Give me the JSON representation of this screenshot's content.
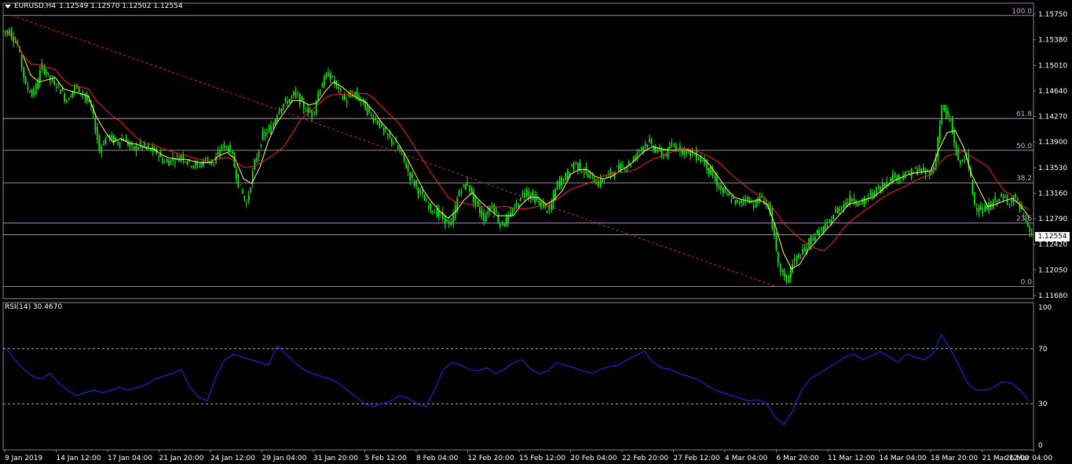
{
  "chart_header": {
    "menu_icon": "triangle-down-icon",
    "symbol": "EURUSD,H4",
    "ohlc": "1.12549 1.12570 1.12502 1.12554"
  },
  "current_price": "1.12554",
  "price_axis_labels": [
    "1.15750",
    "1.15380",
    "1.15010",
    "1.14640",
    "1.14270",
    "1.13900",
    "1.13530",
    "1.13160",
    "1.12790",
    "1.12420",
    "1.12050",
    "1.11680"
  ],
  "fibonacci": {
    "color": "#d0a8e0",
    "levels": [
      {
        "label": "100.0",
        "price": 1.1573
      },
      {
        "label": "61.8",
        "price": 1.1424
      },
      {
        "label": "50.0",
        "price": 1.1378
      },
      {
        "label": "38.2",
        "price": 1.1331
      },
      {
        "label": "23.6",
        "price": 1.1273
      },
      {
        "label": "0.0",
        "price": 1.1181
      }
    ]
  },
  "horizontal_line_price": 1.1256,
  "trendline": {
    "color": "#d03030",
    "from": {
      "x": "9 Jan 2019",
      "y": 1.1573
    },
    "to": {
      "x": "6 Mar 20:00",
      "y": 1.1181
    }
  },
  "time_axis_labels": [
    "9 Jan 2019",
    "14 Jan 12:00",
    "17 Jan 04:00",
    "21 Jan 20:00",
    "24 Jan 12:00",
    "29 Jan 04:00",
    "31 Jan 20:00",
    "5 Feb 12:00",
    "8 Feb 04:00",
    "12 Feb 20:00",
    "15 Feb 12:00",
    "20 Feb 04:00",
    "22 Feb 20:00",
    "27 Feb 12:00",
    "4 Mar 04:00",
    "6 Mar 20:00",
    "11 Mar 12:00",
    "14 Mar 04:00",
    "18 Mar 20:00",
    "21 Mar 12:00",
    "26 Mar 04:00"
  ],
  "rsi_panel": {
    "title": "RSI(14) 30.4670",
    "axis_labels": [
      "100",
      "70",
      "30",
      "0"
    ],
    "levels": [
      70,
      30
    ]
  },
  "colors": {
    "background": "#000000",
    "candles": "#00ff00",
    "ma_fast": "#ffff66",
    "ma_slow": "#ff2020",
    "rsi_line": "#1e2cff",
    "grid_text": "#ffffff"
  },
  "chart_data": {
    "type": "line",
    "series": [
      {
        "name": "EURUSD,H4",
        "values": [
          1.155,
          1.153,
          1.147,
          1.146,
          1.15,
          1.148,
          1.147,
          1.145,
          1.147,
          1.146,
          1.144,
          1.138,
          1.14,
          1.139,
          1.1395,
          1.138,
          1.1385,
          1.138,
          1.1375,
          1.136,
          1.1365,
          1.137,
          1.136,
          1.1355,
          1.1365,
          1.136,
          1.1385,
          1.138,
          1.133,
          1.13,
          1.136,
          1.14,
          1.141,
          1.144,
          1.145,
          1.146,
          1.144,
          1.143,
          1.147,
          1.149,
          1.147,
          1.145,
          1.146,
          1.145,
          1.143,
          1.142,
          1.14,
          1.139,
          1.137,
          1.134,
          1.132,
          1.13,
          1.129,
          1.128,
          1.127,
          1.132,
          1.133,
          1.13,
          1.128,
          1.13,
          1.127,
          1.128,
          1.13,
          1.132,
          1.131,
          1.13,
          1.129,
          1.133,
          1.134,
          1.136,
          1.135,
          1.134,
          1.133,
          1.134,
          1.135,
          1.1355,
          1.136,
          1.138,
          1.139,
          1.138,
          1.137,
          1.1385,
          1.138,
          1.1375,
          1.137,
          1.136,
          1.134,
          1.132,
          1.131,
          1.13,
          1.131,
          1.13,
          1.131,
          1.129,
          1.121,
          1.119,
          1.122,
          1.123,
          1.125,
          1.126,
          1.127,
          1.129,
          1.13,
          1.131,
          1.13,
          1.131,
          1.132,
          1.133,
          1.134,
          1.134,
          1.1345,
          1.135,
          1.1345,
          1.135,
          1.144,
          1.142,
          1.136,
          1.137,
          1.13,
          1.129,
          1.13,
          1.131,
          1.1305,
          1.131,
          1.128,
          1.1255
        ]
      },
      {
        "name": "RSI(14)",
        "values": [
          70,
          62,
          55,
          50,
          48,
          52,
          45,
          40,
          36,
          38,
          40,
          38,
          40,
          42,
          40,
          42,
          44,
          48,
          50,
          52,
          55,
          42,
          35,
          32,
          50,
          62,
          66,
          64,
          62,
          60,
          58,
          72,
          66,
          60,
          55,
          52,
          50,
          48,
          45,
          40,
          35,
          30,
          28,
          30,
          32,
          36,
          34,
          30,
          28,
          40,
          55,
          60,
          58,
          55,
          54,
          56,
          52,
          55,
          60,
          62,
          55,
          52,
          54,
          60,
          58,
          56,
          54,
          52,
          55,
          57,
          58,
          62,
          65,
          68,
          60,
          56,
          55,
          52,
          50,
          48,
          44,
          40,
          38,
          36,
          34,
          32,
          33,
          30,
          20,
          15,
          25,
          40,
          48,
          52,
          56,
          60,
          64,
          66,
          62,
          65,
          68,
          64,
          60,
          66,
          64,
          62,
          66,
          80,
          70,
          58,
          45,
          40,
          40,
          42,
          46,
          45,
          40,
          32
        ]
      }
    ],
    "ylim_price": [
      1.1168,
      1.1575
    ],
    "ylim_rsi": [
      0,
      100
    ],
    "grid": false,
    "legend": "none"
  }
}
